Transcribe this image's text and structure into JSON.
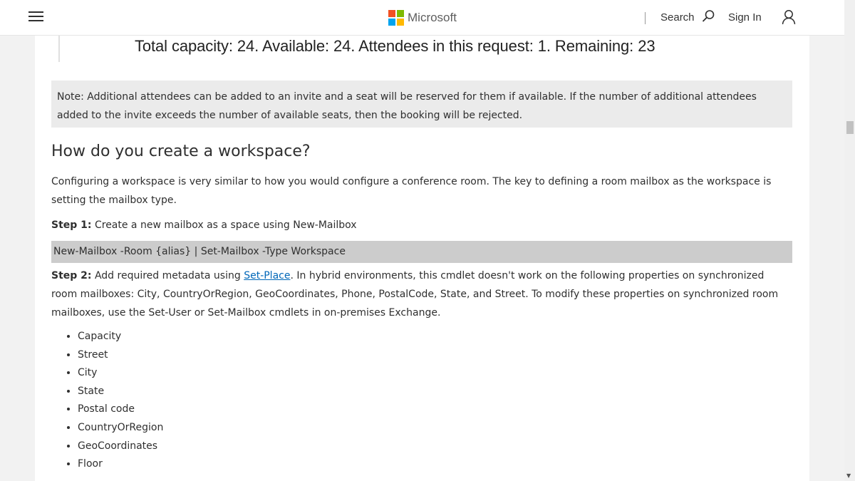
{
  "header": {
    "brand": "Microsoft",
    "brand_colors": [
      "#f25022",
      "#7fba00",
      "#00a4ef",
      "#ffb900"
    ],
    "search_label": "Search",
    "signin_label": "Sign In"
  },
  "article": {
    "image_caption_text": "Total capacity: 24. Available: 24. Attendees in this request: 1. Remaining: 23",
    "note": "Note: Additional attendees can be added to an invite and a seat will be reserved for them if available. If the number of additional attendees added to the invite exceeds the number of available seats, then the booking will be rejected.",
    "heading": "How do you create a workspace?",
    "intro": "Configuring a workspace is very similar to how you would configure a conference room. The key to defining a room mailbox as the workspace is setting the mailbox type.",
    "step1_label": "Step 1:",
    "step1_text": " Create a new mailbox as a space using New-Mailbox",
    "code": "New-Mailbox -Room {alias} | Set-Mailbox -Type Workspace",
    "step2_label": "Step 2:",
    "step2_pre": " Add required metadata using ",
    "step2_link": "Set-Place",
    "step2_post": ". In hybrid environments, this cmdlet doesn't work on the following properties on synchronized room mailboxes: City, CountryOrRegion, GeoCoordinates, Phone, PostalCode, State, and Street. To modify these properties on synchronized room mailboxes, use the Set-User or Set-Mailbox cmdlets in on-premises Exchange.",
    "properties": [
      "Capacity",
      "Street",
      "City",
      "State",
      "Postal code",
      "CountryOrRegion",
      "GeoCoordinates",
      "Floor"
    ]
  },
  "colors": {
    "link": "#0067b8",
    "note_bg": "#ebebeb",
    "code_bg": "#cccccc"
  }
}
